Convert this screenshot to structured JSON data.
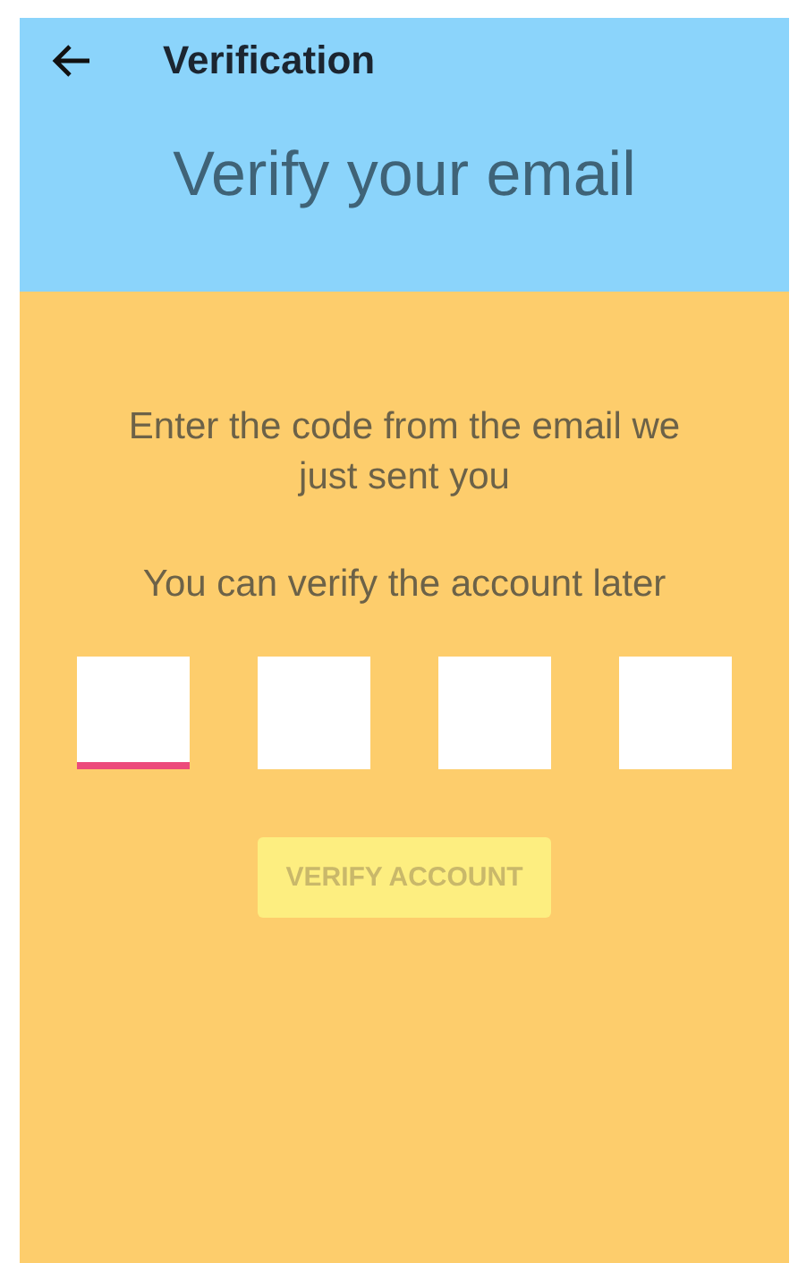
{
  "toolbar": {
    "title": "Verification"
  },
  "header": {
    "heading": "Verify your email"
  },
  "instructions": "Enter the code from the email we just sent you",
  "later_note": "You can verify the account later",
  "code_inputs": [
    {
      "focused": true
    },
    {
      "focused": false
    },
    {
      "focused": false
    },
    {
      "focused": false
    }
  ],
  "verify_button": {
    "label": "VERIFY ACCOUNT",
    "disabled": true
  }
}
